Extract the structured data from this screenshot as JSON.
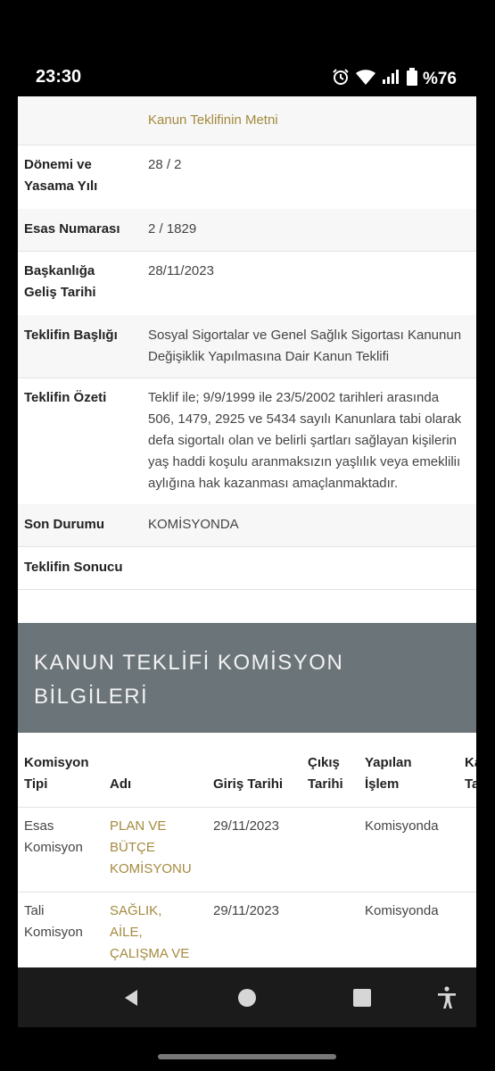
{
  "status_bar": {
    "time": "23:30",
    "battery_text": "%76",
    "icons": [
      "alarm-icon",
      "wifi-icon",
      "signal-icon",
      "battery-icon"
    ]
  },
  "details": {
    "link_text": "Kanun Teklifinin Metni",
    "rows": [
      {
        "label_lines": [
          "Dönemi ve",
          "Yasama Yılı"
        ],
        "value_lines": [
          "28 / 2"
        ]
      },
      {
        "label_lines": [
          "Esas Numarası"
        ],
        "value_lines": [
          "2 / 1829"
        ]
      },
      {
        "label_lines": [
          "Başkanlığa",
          "Geliş Tarihi"
        ],
        "value_lines": [
          "28/11/2023"
        ]
      },
      {
        "label_lines": [
          "Teklifin Başlığı"
        ],
        "value_lines": [
          "Sosyal Sigortalar ve Genel Sağlık Sigortası Kanunun",
          "Değişiklik Yapılmasına Dair Kanun Teklifi"
        ]
      },
      {
        "label_lines": [
          "Teklifin Özeti"
        ],
        "value_lines": [
          "Teklif ile; 9/9/1999 ile 23/5/2002 tarihleri arasında",
          "506, 1479, 2925 ve 5434 sayılı Kanunlara tabi olarak",
          "defa sigortalı olan ve belirli şartları sağlayan kişilerin",
          "yaş haddi koşulu aranmaksızın yaşlılık veya emekliliı",
          "aylığına hak kazanması amaçlanmaktadır."
        ]
      },
      {
        "label_lines": [
          "Son Durumu"
        ],
        "value_lines": [
          "KOMİSYONDA"
        ]
      },
      {
        "label_lines": [
          "Teklifin Sonucu"
        ],
        "value_lines": [
          ""
        ]
      }
    ]
  },
  "commission_section": {
    "title_lines": [
      "KANUN TEKLİFİ KOMİSYON",
      "BİLGİLERİ"
    ],
    "headers": [
      {
        "lines": [
          "Komisyon",
          "Tipi"
        ]
      },
      {
        "lines": [
          "",
          "Adı"
        ]
      },
      {
        "lines": [
          "",
          "Giriş Tarihi"
        ]
      },
      {
        "lines": [
          "Çıkış",
          "Tarihi"
        ]
      },
      {
        "lines": [
          "Yapılan",
          "İşlem"
        ]
      },
      {
        "lines": [
          "Ka",
          "Ta"
        ]
      }
    ],
    "rows": [
      {
        "type_lines": [
          "Esas",
          "Komisyon"
        ],
        "name_lines": [
          "PLAN VE",
          "BÜTÇE",
          "KOMİSYONU"
        ],
        "entry_date": "29/11/2023",
        "exit_date": "",
        "action": "Komisyonda"
      },
      {
        "type_lines": [
          "Tali",
          "Komisyon"
        ],
        "name_lines": [
          "SAĞLIK,",
          "AİLE,",
          "ÇALIŞMA VE"
        ],
        "entry_date": "29/11/2023",
        "exit_date": "",
        "action": "Komisyonda"
      }
    ]
  },
  "nav_bar": {
    "buttons": [
      "back-icon",
      "home-icon",
      "recents-icon",
      "accessibility-icon"
    ]
  }
}
